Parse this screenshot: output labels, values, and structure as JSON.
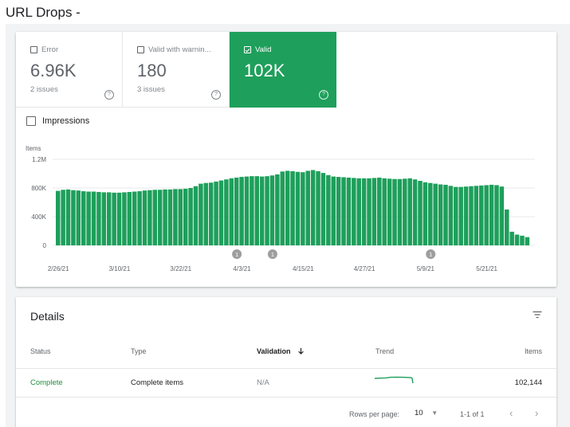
{
  "page_title": "URL Drops -",
  "tiles": [
    {
      "label": "Error",
      "value": "6.96K",
      "sub": "2 issues",
      "checked": false
    },
    {
      "label": "Valid with warnin...",
      "value": "180",
      "sub": "3 issues",
      "checked": false
    },
    {
      "label": "Valid",
      "value": "102K",
      "sub": "",
      "checked": true
    }
  ],
  "colors": {
    "accent": "#1e9f5b",
    "annotation": "#9e9e9e",
    "link": "#1e8e3e"
  },
  "impressions_label": "Impressions",
  "chart_data": {
    "type": "bar",
    "ylabel": "Items",
    "ylim": [
      0,
      1200000
    ],
    "yticks": [
      0,
      400000,
      800000,
      1200000
    ],
    "ytick_labels": [
      "0",
      "400K",
      "800K",
      "1.2M"
    ],
    "xtick_labels": [
      "2/26/21",
      "3/10/21",
      "3/22/21",
      "4/3/21",
      "4/15/21",
      "4/27/21",
      "5/9/21",
      "5/21/21"
    ],
    "xtick_index": [
      0,
      12,
      24,
      36,
      48,
      60,
      72,
      84
    ],
    "annotations": [
      {
        "index": 35,
        "label": "1"
      },
      {
        "index": 42,
        "label": "1"
      },
      {
        "index": 73,
        "label": "1"
      }
    ],
    "grid": true,
    "color": "#1e9f5b",
    "values": [
      760000,
      775000,
      780000,
      770000,
      765000,
      755000,
      750000,
      750000,
      745000,
      740000,
      740000,
      735000,
      735000,
      740000,
      745000,
      750000,
      755000,
      765000,
      770000,
      775000,
      775000,
      780000,
      780000,
      785000,
      785000,
      790000,
      800000,
      825000,
      860000,
      870000,
      875000,
      890000,
      905000,
      920000,
      935000,
      945000,
      955000,
      960000,
      965000,
      965000,
      960000,
      965000,
      975000,
      990000,
      1030000,
      1040000,
      1035000,
      1025000,
      1020000,
      1040000,
      1050000,
      1035000,
      1010000,
      980000,
      960000,
      955000,
      950000,
      945000,
      940000,
      935000,
      935000,
      935000,
      940000,
      945000,
      935000,
      930000,
      925000,
      925000,
      930000,
      935000,
      920000,
      900000,
      880000,
      870000,
      860000,
      850000,
      845000,
      830000,
      815000,
      815000,
      820000,
      825000,
      830000,
      835000,
      840000,
      845000,
      840000,
      820000,
      500000,
      190000,
      150000,
      135000,
      115000
    ]
  },
  "details": {
    "title": "Details",
    "columns": [
      "Status",
      "Type",
      "Validation",
      "Trend",
      "Items"
    ],
    "rows": [
      {
        "status": "Complete",
        "type": "Complete items",
        "validation": "N/A",
        "items": "102,144"
      }
    ],
    "footer": {
      "rows_per_page_label": "Rows per page:",
      "rows_per_page": "10",
      "range": "1-1 of 1"
    }
  }
}
